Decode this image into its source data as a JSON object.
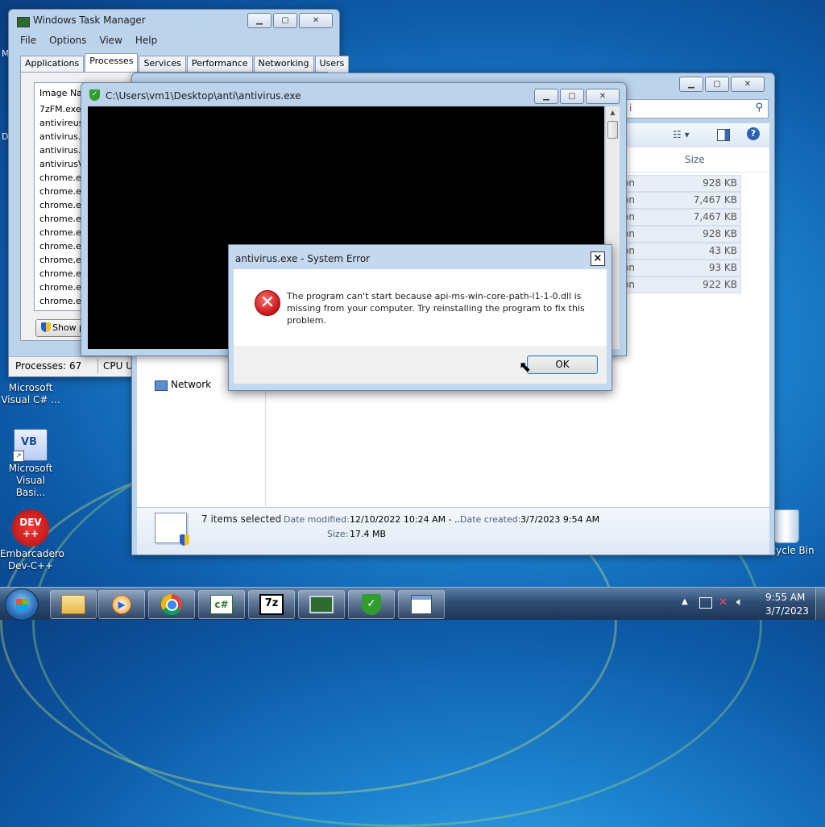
{
  "task_manager": {
    "title": "Windows Task Manager",
    "menu": [
      "File",
      "Options",
      "View",
      "Help"
    ],
    "tabs": [
      "Applications",
      "Processes",
      "Services",
      "Performance",
      "Networking",
      "Users"
    ],
    "active_tab": "Processes",
    "column_header": "Image Nam",
    "processes": [
      "7zFM.exe",
      "antivireus.",
      "antivirus.e",
      "antivirus.e",
      "antivirusV2",
      "chrome.ex",
      "chrome.ex",
      "chrome.ex",
      "chrome.ex",
      "chrome.ex",
      "chrome.ex",
      "chrome.ex",
      "chrome.ex",
      "chrome.ex",
      "chrome.ex"
    ],
    "show_button": "Show p",
    "status_processes": "Processes: 67",
    "status_cpu": "CPU Us"
  },
  "explorer": {
    "search_placeholder": "i",
    "size_header": "Size",
    "rows": [
      {
        "type": "on",
        "size": "928 KB"
      },
      {
        "type": "on",
        "size": "7,467 KB"
      },
      {
        "type": "on",
        "size": "7,467 KB"
      },
      {
        "type": "on",
        "size": "928 KB"
      },
      {
        "type": "on",
        "size": "43 KB"
      },
      {
        "type": "on",
        "size": "93 KB"
      },
      {
        "type": "on",
        "size": "922 KB"
      }
    ],
    "nav_network": "Network",
    "details_selected": "7 items selected",
    "details_modified_label": "Date modified:",
    "details_modified_value": "12/10/2022 10:24 AM - ...",
    "details_created_label": "Date created:",
    "details_created_value": "3/7/2023 9:54 AM",
    "details_size_label": "Size:",
    "details_size_value": "17.4 MB"
  },
  "console": {
    "title": "C:\\Users\\vm1\\Desktop\\anti\\antivirus.exe"
  },
  "error_dialog": {
    "title": "antivirus.exe - System Error",
    "message_line1": "The program can't start because api-ms-win-core-path-l1-1-0.dll is",
    "message_line2": "missing from your computer. Try reinstalling the program to fix this",
    "message_line3": "problem.",
    "ok_label": "OK",
    "close_label": "×"
  },
  "desktop": {
    "icons": [
      {
        "label_line1": "Microsoft",
        "label_line2": "Visual C# ..."
      },
      {
        "label_line1": "Microsoft",
        "label_line2": "Visual Basi..."
      },
      {
        "label_line1": "Embarcadero",
        "label_line2": "Dev-C++"
      },
      {
        "label_line1": "Recycle Bin",
        "label_line2": ""
      }
    ],
    "edge_letters": [
      "M",
      "D"
    ]
  },
  "taskbar": {
    "time": "9:55 AM",
    "date": "3/7/2023",
    "csharp_label": "c#",
    "sevenzip_label": "7z",
    "vb_label": "VB",
    "devcpp_label": "DEV\n++"
  },
  "colors": {
    "accent_green": "#2f9e2f",
    "error_red": "#c9141c",
    "console_bg": "#000000"
  }
}
